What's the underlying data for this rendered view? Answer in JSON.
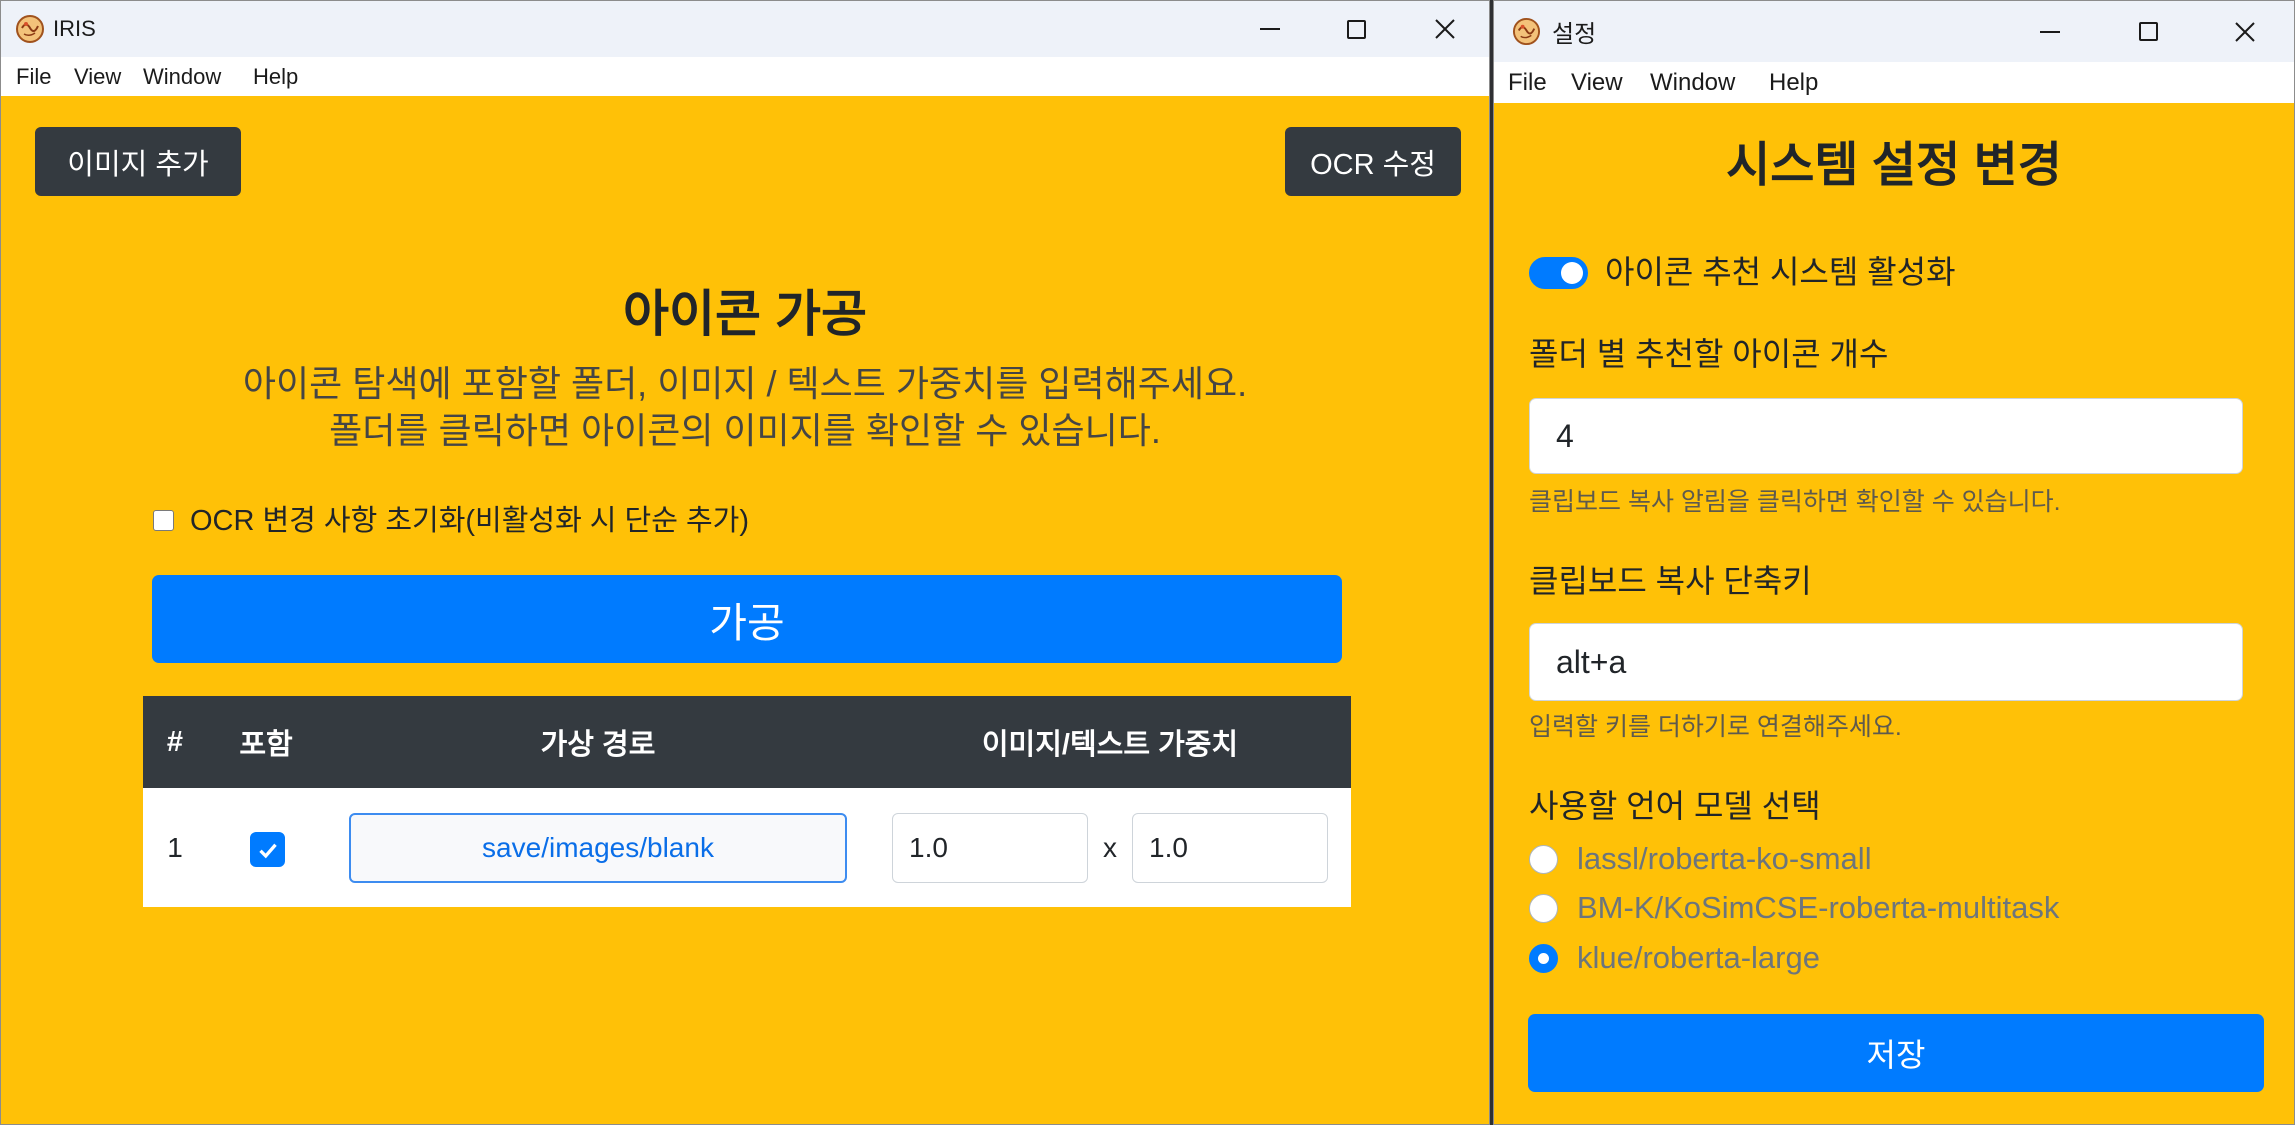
{
  "colors": {
    "content_background": "#ffc107",
    "dark_button": "#343a40",
    "primary": "#007bff",
    "titlebar": "#eef2f9"
  },
  "main_window": {
    "title": "IRIS",
    "icon": "app-logo-icon",
    "window_controls": [
      "minimize-icon",
      "maximize-icon",
      "close-icon"
    ],
    "menu": [
      "File",
      "View",
      "Window",
      "Help"
    ],
    "add_image_button": "이미지 추가",
    "edit_ocr_button": "OCR 수정",
    "heading": "아이콘 가공",
    "description": [
      "아이콘 탐색에 포함할 폴더, 이미지 / 텍스트 가중치를 입력해주세요.",
      "폴더를 클릭하면 아이콘의 이미지를 확인할 수 있습니다."
    ],
    "reset_ocr": {
      "label": "OCR 변경 사항 초기화(비활성화 시 단순 추가)",
      "checked": false
    },
    "process_button": "가공",
    "table": {
      "headers": [
        "#",
        "포함",
        "가상 경로",
        "이미지/텍스트 가중치"
      ],
      "rows": [
        {
          "index": "1",
          "included": true,
          "path": "save/images/blank",
          "image_weight": "1.0",
          "separator": "x",
          "text_weight": "1.0"
        }
      ]
    }
  },
  "settings_window": {
    "title": "설정",
    "icon": "app-logo-icon",
    "window_controls": [
      "minimize-icon",
      "maximize-icon",
      "close-icon"
    ],
    "menu": [
      "File",
      "View",
      "Window",
      "Help"
    ],
    "heading": "시스템 설정 변경",
    "recommend_toggle": {
      "label": "아이콘 추천 시스템 활성화",
      "on": true
    },
    "icons_per_folder": {
      "label": "폴더 별 추천할 아이콘 개수",
      "value": "4",
      "help": "클립보드 복사 알림을 클릭하면 확인할 수 있습니다."
    },
    "clipboard_shortcut": {
      "label": "클립보드 복사 단축키",
      "value": "alt+a",
      "help": "입력할 키를 더하기로 연결해주세요."
    },
    "language_model": {
      "label": "사용할 언어 모델 선택",
      "options": [
        {
          "label": "lassl/roberta-ko-small",
          "selected": false
        },
        {
          "label": "BM-K/KoSimCSE-roberta-multitask",
          "selected": false
        },
        {
          "label": "klue/roberta-large",
          "selected": true
        }
      ]
    },
    "save_button": "저장"
  }
}
